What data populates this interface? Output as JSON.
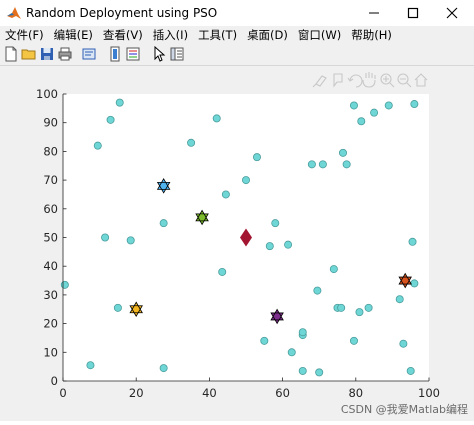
{
  "window": {
    "title": "Random Deployment using PSO"
  },
  "menu": [
    "文件(F)",
    "编辑(E)",
    "查看(V)",
    "插入(I)",
    "工具(T)",
    "桌面(D)",
    "窗口(W)",
    "帮助(H)"
  ],
  "toolbar_icons": [
    "new-file-icon",
    "open-folder-icon",
    "save-icon",
    "print-icon",
    "print-preview-icon",
    "link-plot-icon",
    "insert-colorbar-icon",
    "insert-legend-icon",
    "edit-plot-arrow-icon",
    "property-inspector-icon"
  ],
  "axes_toolbar_icons": [
    "brush-icon",
    "data-tips-icon",
    "rotate-icon",
    "pan-icon",
    "zoom-in-icon",
    "zoom-out-icon",
    "home-icon"
  ],
  "watermark": "CSDN @我爱Matlab编程",
  "chart_data": {
    "type": "scatter",
    "title": "",
    "xlabel": "",
    "ylabel": "",
    "xlim": [
      0,
      100
    ],
    "ylim": [
      0,
      100
    ],
    "xticks": [
      0,
      20,
      40,
      60,
      80,
      100
    ],
    "yticks": [
      0,
      10,
      20,
      30,
      40,
      50,
      60,
      70,
      80,
      90,
      100
    ],
    "grid": false,
    "series": [
      {
        "marker": "circle",
        "color": "#6fd6d6",
        "points": [
          [
            15.5,
            97
          ],
          [
            13,
            91
          ],
          [
            9.5,
            82
          ],
          [
            42,
            91.5
          ],
          [
            35,
            83
          ],
          [
            53,
            78
          ],
          [
            50,
            70
          ],
          [
            44.5,
            65
          ],
          [
            27.5,
            55
          ],
          [
            58,
            55
          ],
          [
            11.5,
            50
          ],
          [
            18.5,
            49
          ],
          [
            56.5,
            47
          ],
          [
            61.5,
            47.5
          ],
          [
            43.5,
            38
          ],
          [
            0.5,
            33.5
          ],
          [
            15,
            25.5
          ],
          [
            55,
            14
          ],
          [
            62.5,
            10
          ],
          [
            65.5,
            16
          ],
          [
            65.5,
            17
          ],
          [
            65.5,
            3.5
          ],
          [
            70,
            3
          ],
          [
            74,
            39
          ],
          [
            69.5,
            31.5
          ],
          [
            75,
            25.5
          ],
          [
            77.5,
            75.5
          ],
          [
            76.5,
            79.5
          ],
          [
            68,
            75.5
          ],
          [
            71,
            75.5
          ],
          [
            79.5,
            96
          ],
          [
            81.5,
            90.5
          ],
          [
            85,
            93.5
          ],
          [
            89,
            96
          ],
          [
            96,
            96.5
          ],
          [
            76,
            25.5
          ],
          [
            79.5,
            14
          ],
          [
            81,
            24
          ],
          [
            83.5,
            25.5
          ],
          [
            92,
            28.5
          ],
          [
            95.5,
            48.5
          ],
          [
            96,
            34
          ],
          [
            93,
            13
          ],
          [
            95,
            3.5
          ],
          [
            27.5,
            4.5
          ],
          [
            7.5,
            5.5
          ]
        ]
      },
      {
        "marker": "hexagram",
        "color": "#4fb3f0",
        "points": [
          [
            27.5,
            68
          ]
        ]
      },
      {
        "marker": "hexagram",
        "color": "#7cbb2c",
        "points": [
          [
            38,
            57
          ]
        ]
      },
      {
        "marker": "hexagram",
        "color": "#f2b41f",
        "points": [
          [
            20,
            25
          ]
        ]
      },
      {
        "marker": "hexagram",
        "color": "#7e2f8e",
        "points": [
          [
            58.5,
            22.5
          ]
        ]
      },
      {
        "marker": "hexagram",
        "color": "#d9531e",
        "points": [
          [
            93.5,
            35
          ]
        ]
      },
      {
        "marker": "diamond",
        "color": "#a2142f",
        "points": [
          [
            50,
            50
          ]
        ]
      }
    ]
  }
}
